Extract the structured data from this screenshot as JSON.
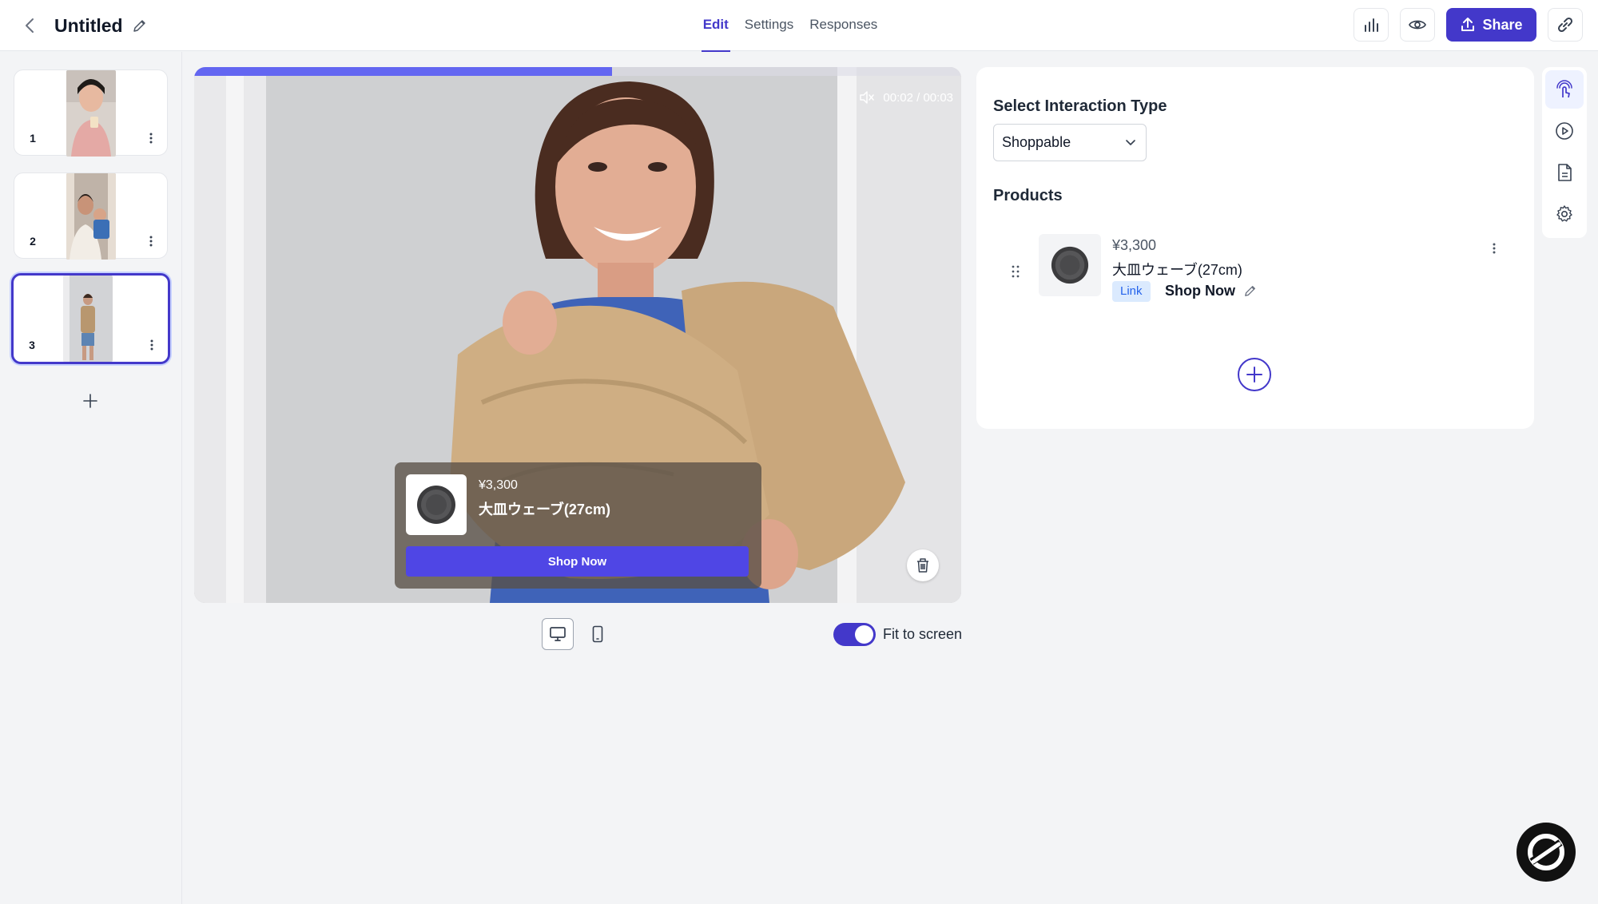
{
  "header": {
    "title": "Untitled",
    "tabs": [
      {
        "label": "Edit",
        "active": true
      },
      {
        "label": "Settings",
        "active": false
      },
      {
        "label": "Responses",
        "active": false
      }
    ],
    "share_label": "Share"
  },
  "sidebar": {
    "slides": [
      {
        "number": "1",
        "selected": false
      },
      {
        "number": "2",
        "selected": false
      },
      {
        "number": "3",
        "selected": true
      }
    ]
  },
  "video": {
    "time": "00:02 / 00:03",
    "progress": 0.545,
    "product_card": {
      "price": "¥3,300",
      "name": "大皿ウェーブ(27cm)",
      "button_label": "Shop Now"
    }
  },
  "preview_controls": {
    "fit_to_screen_label": "Fit to screen",
    "fit_to_screen": true,
    "device": "desktop"
  },
  "panel": {
    "interaction_heading": "Select Interaction Type",
    "interaction_type": "Shoppable",
    "products_heading": "Products",
    "products": [
      {
        "price": "¥3,300",
        "name": "大皿ウェーブ(27cm)",
        "badge": "Link",
        "cta": "Shop Now"
      }
    ]
  },
  "colors": {
    "accent": "#4338ca",
    "progress": "#6366f1"
  },
  "icons": {
    "header": [
      "chevron-left-icon",
      "pencil-icon",
      "bar-chart-icon",
      "eye-icon",
      "upload-icon",
      "link-icon"
    ],
    "rail": [
      "touch-icon",
      "play-circle-icon",
      "document-icon",
      "gear-icon"
    ]
  }
}
